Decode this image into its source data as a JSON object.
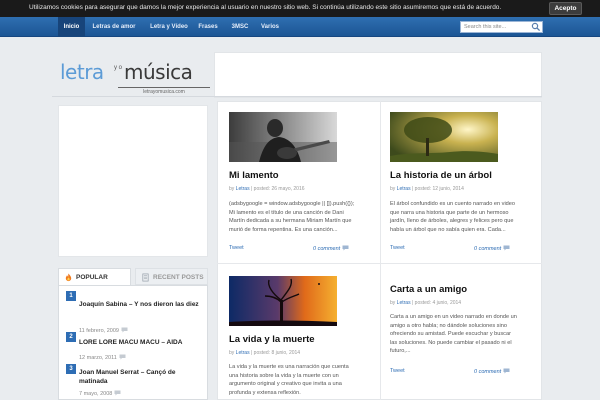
{
  "cookie_bar": {
    "text": "Utilizamos cookies para asegurar que damos la mejor experiencia al usuario en nuestro sitio web. Si continúa utilizando este sitio asumiremos que está de acuerdo.",
    "accept_label": "Acepto"
  },
  "nav": {
    "items": [
      {
        "label": "Inicio",
        "active": true
      },
      {
        "label": "Letras de amor"
      },
      {
        "label": "Letra y Vídeo"
      },
      {
        "label": "Frases"
      },
      {
        "label": "3MSC"
      },
      {
        "label": "Varios"
      }
    ],
    "search_placeholder": "Search this site..."
  },
  "logo": {
    "part1": "letra",
    "yo": "y o",
    "part2": "música",
    "url": "letrayomusica.com"
  },
  "sidebar": {
    "tabs": [
      {
        "label": "POPULAR POSTS",
        "icon": "flame-icon"
      },
      {
        "label": "RECENT POSTS",
        "icon": "document-icon"
      }
    ],
    "popular": [
      {
        "num": "1",
        "title": "Joaquín Sabina – Y nos dieron las diez",
        "date": "11 febrero, 2009"
      },
      {
        "num": "2",
        "title": "LORE LORE MACU MACU – AIDA",
        "date": "12 marzo, 2011"
      },
      {
        "num": "3",
        "title": "Joan Manuel Serrat – Cançó de matinada",
        "date": "7 mayo, 2008"
      }
    ]
  },
  "posts": [
    {
      "title": "Mi lamento",
      "by_prefix": "by",
      "author": "Letras",
      "posted": "| posted: 26 mayo, 2016",
      "excerpt": "(adsbygoogle = window.adsbygoogle || []).push({}); Mi lamento es el título de una canción de Dani Martín dedicada a su hermana Miriam Martín que murió de forma repentina. Es una canción...",
      "tweet": "Tweet",
      "comments": "0 comment"
    },
    {
      "title": "La historia de un árbol",
      "by_prefix": "by",
      "author": "Letras",
      "posted": "| posted: 12 junio, 2014",
      "excerpt": "El árbol confundido es un cuento narrado en video que narra una historia que parte de un hermoso jardín, lleno de árboles, alegres y felices pero que había un árbol que no sabía quien era. Cada...",
      "tweet": "Tweet",
      "comments": "0 comment"
    },
    {
      "title": "La vida y la muerte",
      "by_prefix": "by",
      "author": "Letras",
      "posted": "| posted: 8 junio, 2014",
      "excerpt": "La vida y la muerte es una narración que cuenta una historia sobre la vida y la muerte con un argumento original y creativo que invita a una profunda y extensa reflexión.",
      "tweet": "",
      "comments": ""
    },
    {
      "title": "Carta a un amigo",
      "by_prefix": "by",
      "author": "Letras",
      "posted": "| posted: 4 junio, 2014",
      "excerpt": "Carta a un amigo en un video narrado en donde un amigo a otro habla; no dándole soluciones sino ofreciendo su amistad. Puede escuchar y buscar las soluciones. No puede cambiar el pasado ni el futuro,...",
      "tweet": "Tweet",
      "comments": "0 comment"
    }
  ],
  "colors": {
    "nav_blue": "#2f6fb1",
    "accent": "#2e6db4",
    "cookie_bg": "#1a1a1a"
  }
}
